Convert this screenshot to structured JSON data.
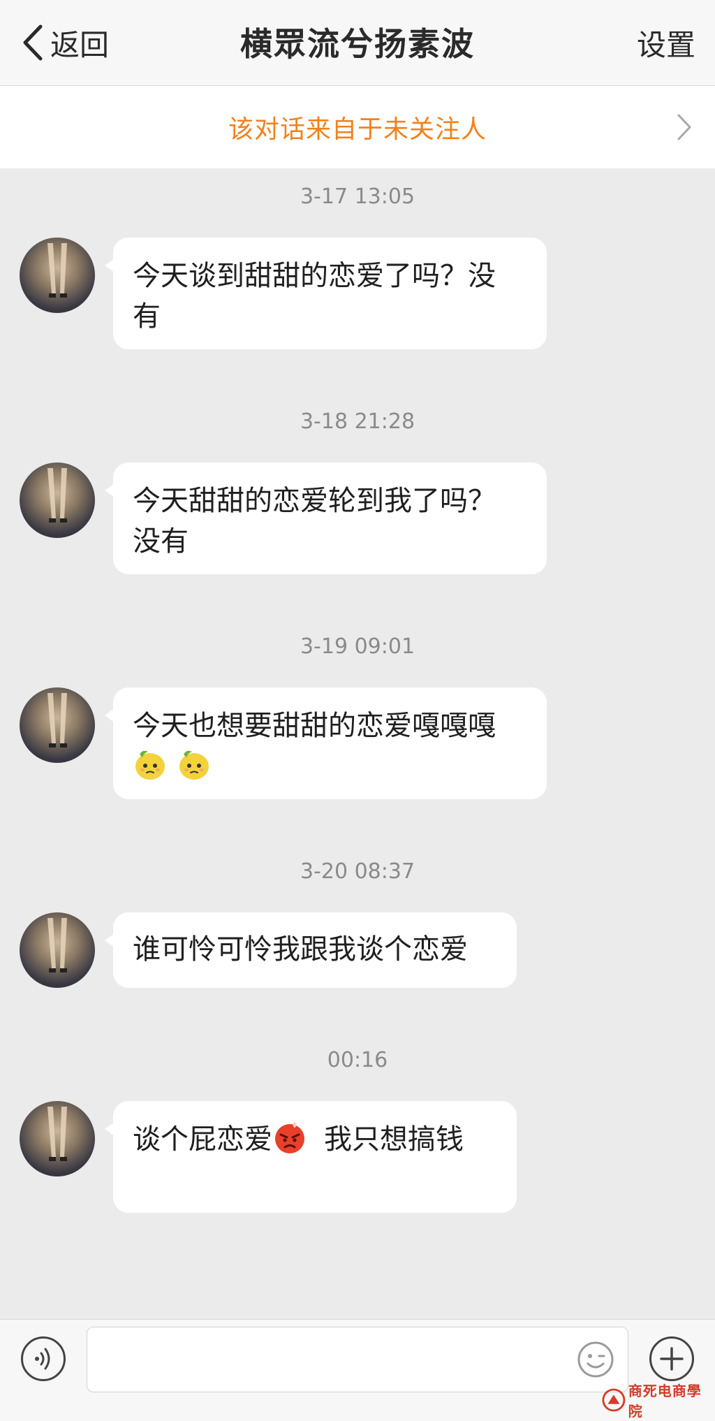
{
  "header": {
    "back_label": "返回",
    "title": "横眾流兮扬素波",
    "settings_label": "设置"
  },
  "banner": {
    "text": "该对话来自于未关注人"
  },
  "messages": [
    {
      "timestamp": "3-17 13:05",
      "line1": "今天谈到甜甜的恋爱了吗？没",
      "line2": "有"
    },
    {
      "timestamp": "3-18 21:28",
      "line1": "今天甜甜的恋爱轮到我了吗？",
      "line2": "没有"
    },
    {
      "timestamp": "3-19 09:01",
      "line1": "今天也想要甜甜的恋爱嘎嘎嘎",
      "emojis": [
        "lemon-face-emoji",
        "lemon-face-emoji"
      ]
    },
    {
      "timestamp": "3-20 08:37",
      "line1": "谁可怜可怜我跟我谈个恋爱"
    },
    {
      "timestamp": "00:16",
      "text_before": "谈个屁恋爱",
      "emoji": "angry-face-emoji",
      "text_after": "我只想搞钱"
    }
  ],
  "input": {
    "value": "",
    "placeholder": ""
  },
  "watermark": {
    "text": "商死电商學院"
  },
  "colors": {
    "banner_text": "#f0821e",
    "timestamp": "#8a8a8a",
    "chat_bg": "#ebebeb",
    "bubble_bg": "#ffffff"
  }
}
